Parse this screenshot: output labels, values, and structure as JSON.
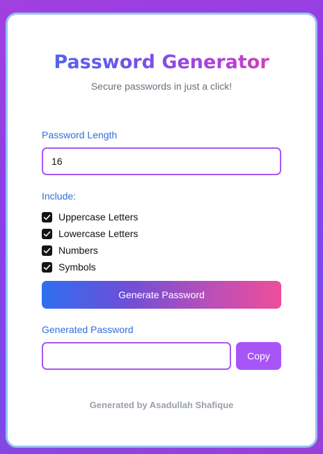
{
  "header": {
    "title": "Password Generator",
    "subtitle": "Secure passwords in just a click!"
  },
  "length": {
    "label": "Password Length",
    "value": "16"
  },
  "include": {
    "label": "Include:",
    "options": [
      {
        "label": "Uppercase Letters",
        "checked": true
      },
      {
        "label": "Lowercase Letters",
        "checked": true
      },
      {
        "label": "Numbers",
        "checked": true
      },
      {
        "label": "Symbols",
        "checked": true
      }
    ]
  },
  "generate_button": {
    "label": "Generate Password"
  },
  "output": {
    "label": "Generated Password",
    "value": "",
    "copy_label": "Copy"
  },
  "footer": {
    "text": "Generated by Asadullah Shafique"
  },
  "icons": {
    "checkbox": "check-icon"
  },
  "colors": {
    "accent": "#a855f7",
    "label_blue": "#2f6fd8",
    "card_border": "#93c0f3",
    "title_gradient": [
      "#3b6ff0",
      "#b43fd8",
      "#e5459a"
    ],
    "button_gradient": [
      "#2f6ff0",
      "#ef4d9a"
    ]
  }
}
